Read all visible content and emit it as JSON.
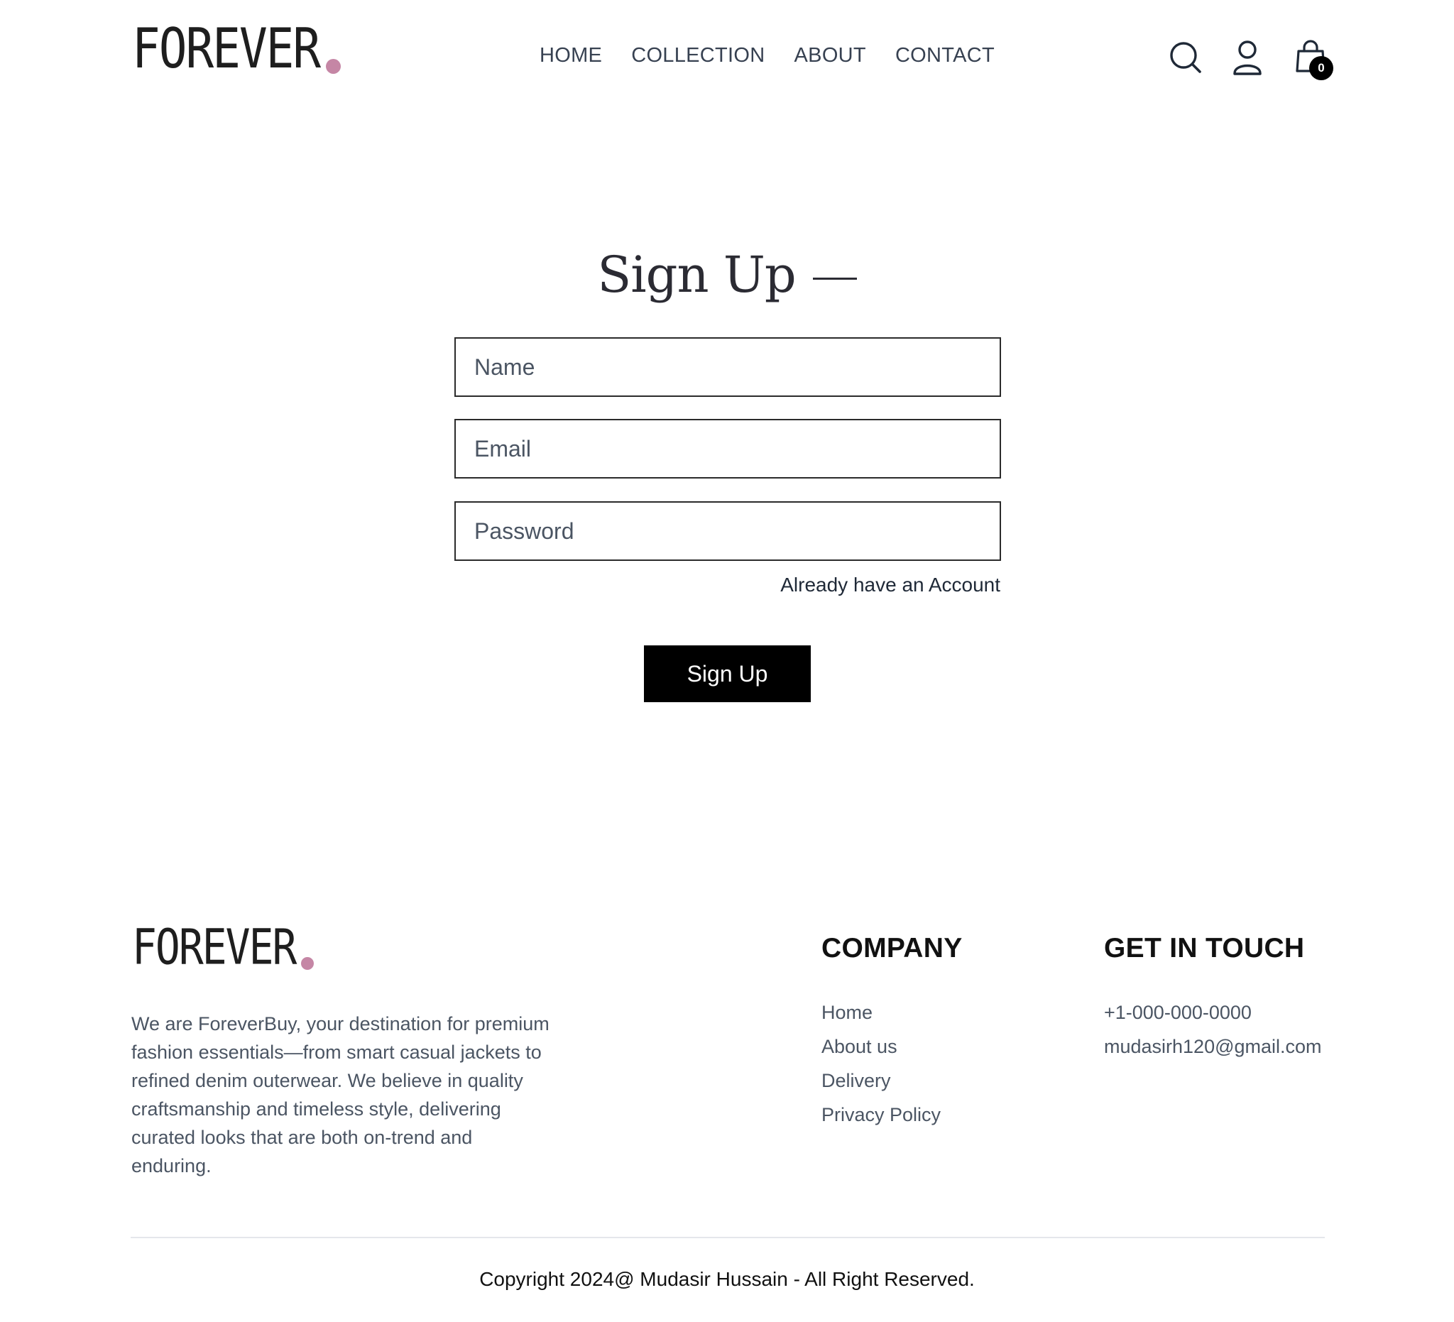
{
  "brand": {
    "name": "FOREVER",
    "dot_color": "#c586a5"
  },
  "nav": {
    "items": [
      {
        "label": "HOME"
      },
      {
        "label": "COLLECTION"
      },
      {
        "label": "ABOUT"
      },
      {
        "label": "CONTACT"
      }
    ]
  },
  "header_icons": {
    "search": "search-icon",
    "profile": "user-icon",
    "cart": "shopping-bag-icon",
    "cart_count": "0"
  },
  "form": {
    "title": "Sign Up",
    "name_placeholder": "Name",
    "email_placeholder": "Email",
    "password_placeholder": "Password",
    "name_value": "",
    "email_value": "",
    "password_value": "",
    "already_link": "Already have an Account",
    "submit_label": "Sign Up"
  },
  "footer": {
    "about": "We are ForeverBuy, your destination for premium fashion essentials—from smart casual jackets to refined denim outerwear. We believe in quality craftsmanship and timeless style, delivering curated looks that are both on-trend and enduring.",
    "company": {
      "title": "COMPANY",
      "links": [
        "Home",
        "About us",
        "Delivery",
        "Privacy Policy"
      ]
    },
    "contact": {
      "title": "GET IN TOUCH",
      "phone": "+1-000-000-0000",
      "email": "mudasirh120@gmail.com"
    },
    "copyright": "Copyright 2024@ Mudasir Hussain - All Right Reserved."
  },
  "colors": {
    "primary": "#000000",
    "text": "#374151",
    "muted": "#4b5563",
    "divider": "#e5e7eb"
  }
}
